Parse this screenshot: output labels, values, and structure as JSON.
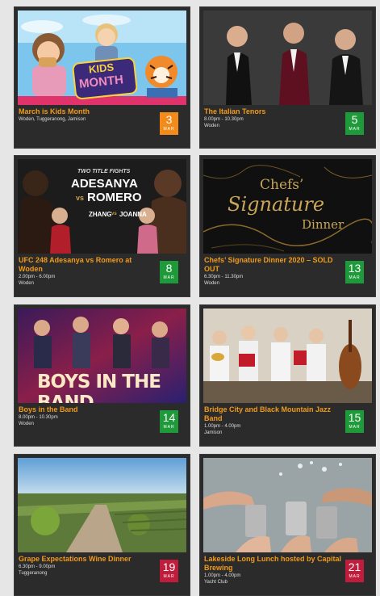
{
  "colors": {
    "title": "#f19a1a",
    "card_bg": "#2b2b2b",
    "badge_orange": "#f38b1b",
    "badge_green": "#1f9a3a",
    "badge_red": "#c01c3c"
  },
  "events": [
    {
      "title": "March is Kids Month",
      "line1": "Woden, Tuggeranong, Jamison",
      "line2": "",
      "day": "3",
      "month": "MAR",
      "badge": "orange",
      "image": "kids-month"
    },
    {
      "title": "The Italian Tenors",
      "line1": "8.00pm - 10.30pm",
      "line2": "Woden",
      "day": "5",
      "month": "MAR",
      "badge": "green",
      "image": "tenors"
    },
    {
      "title": "UFC 248 Adesanya vs Romero at Woden",
      "line1": "2.00pm - 6.00pm",
      "line2": "Woden",
      "day": "8",
      "month": "MAR",
      "badge": "green",
      "image": "ufc"
    },
    {
      "title": "Chefs’ Signature Dinner 2020 – SOLD OUT",
      "line1": "6.30pm - 11.30pm",
      "line2": "Woden",
      "day": "13",
      "month": "MAR",
      "badge": "green",
      "image": "chefs"
    },
    {
      "title": "Boys in the Band",
      "line1": "8.00pm - 10.30pm",
      "line2": "Woden",
      "day": "14",
      "month": "MAR",
      "badge": "green",
      "image": "boys"
    },
    {
      "title": "Bridge City and Black Mountain Jazz Band",
      "line1": "1.00pm - 4.00pm",
      "line2": "Jamison",
      "day": "15",
      "month": "MAR",
      "badge": "green",
      "image": "jazz"
    },
    {
      "title": "Grape Expectations Wine Dinner",
      "line1": "6.30pm - 9.00pm",
      "line2": "Tuggeranong",
      "day": "19",
      "month": "MAR",
      "badge": "red",
      "image": "vineyard"
    },
    {
      "title": "Lakeside Long Lunch hosted by Capital Brewing",
      "line1": "1.00pm - 4.00pm",
      "line2": "Yacht Club",
      "day": "21",
      "month": "MAR",
      "badge": "red",
      "image": "cheers"
    }
  ],
  "artwork": {
    "kids_logo_line1": "KIDS",
    "kids_logo_line2": "MONTH",
    "ufc_tagline": "TWO TITLE FIGHTS",
    "ufc_fighter1": "ADESANYA",
    "ufc_vs": "vs",
    "ufc_fighter2": "ROMERO",
    "ufc_undercard1": "ZHANG",
    "ufc_undercard_vs": "vs",
    "ufc_undercard2": "JOANNA",
    "chefs_line1": "Chefs’",
    "chefs_line2": "Signature",
    "chefs_line3": "Dinner",
    "boys_banner": "BOYS IN THE BAND"
  }
}
